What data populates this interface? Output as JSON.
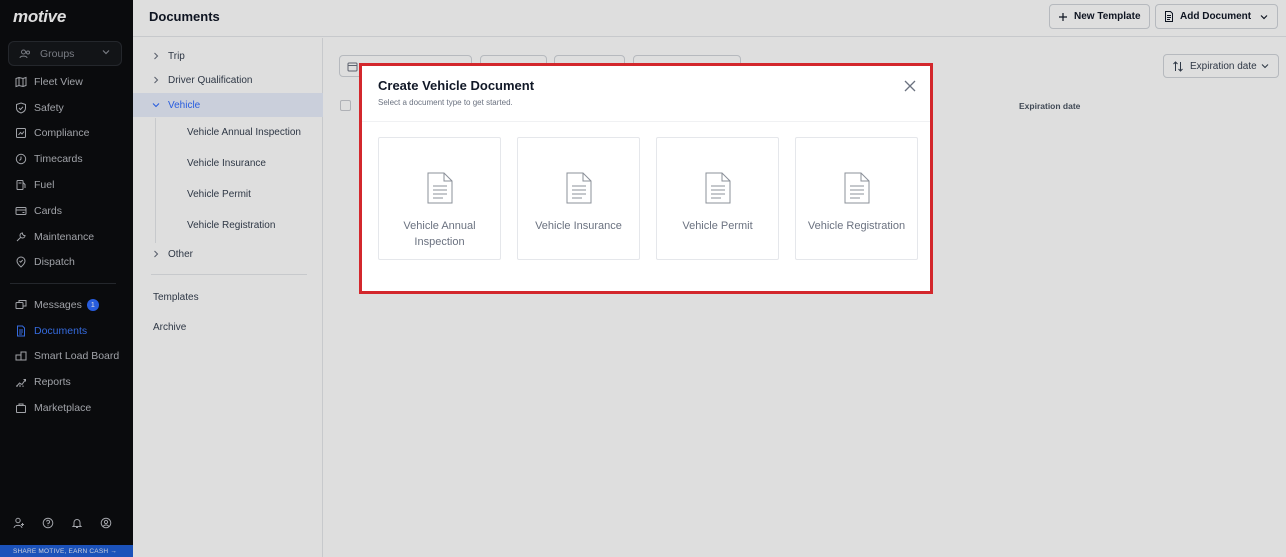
{
  "sidebar": {
    "logo": "motive",
    "groups_label": "Groups",
    "items": [
      {
        "label": "Fleet View",
        "icon": "map-icon"
      },
      {
        "label": "Safety",
        "icon": "shield-icon"
      },
      {
        "label": "Compliance",
        "icon": "compliance-icon"
      },
      {
        "label": "Timecards",
        "icon": "clock-icon"
      },
      {
        "label": "Fuel",
        "icon": "fuel-icon"
      },
      {
        "label": "Cards",
        "icon": "card-icon"
      },
      {
        "label": "Maintenance",
        "icon": "wrench-icon"
      },
      {
        "label": "Dispatch",
        "icon": "dispatch-icon"
      }
    ],
    "items2": [
      {
        "label": "Messages",
        "icon": "messages-icon",
        "badge": "1"
      },
      {
        "label": "Documents",
        "icon": "document-icon",
        "active": true
      },
      {
        "label": "Smart Load Board",
        "icon": "load-board-icon"
      },
      {
        "label": "Reports",
        "icon": "reports-icon"
      },
      {
        "label": "Marketplace",
        "icon": "marketplace-icon"
      }
    ],
    "promo": "SHARE MOTIVE, EARN CASH →"
  },
  "header": {
    "title": "Documents",
    "new_template": "New Template",
    "add_document": "Add Document"
  },
  "tree": {
    "items": [
      "Trip",
      "Driver Qualification",
      "Vehicle"
    ],
    "vehicle_children": [
      "Vehicle Annual Inspection",
      "Vehicle Insurance",
      "Vehicle Permit",
      "Vehicle Registration"
    ],
    "other": "Other",
    "templates": "Templates",
    "archive": "Archive"
  },
  "main": {
    "sort_label": "Expiration date",
    "column_expiration": "Expiration date"
  },
  "modal": {
    "title": "Create Vehicle Document",
    "subtitle": "Select a document type to get started.",
    "cards": [
      "Vehicle Annual Inspection",
      "Vehicle Insurance",
      "Vehicle Permit",
      "Vehicle Registration"
    ],
    "border_color": "#d3272c"
  }
}
